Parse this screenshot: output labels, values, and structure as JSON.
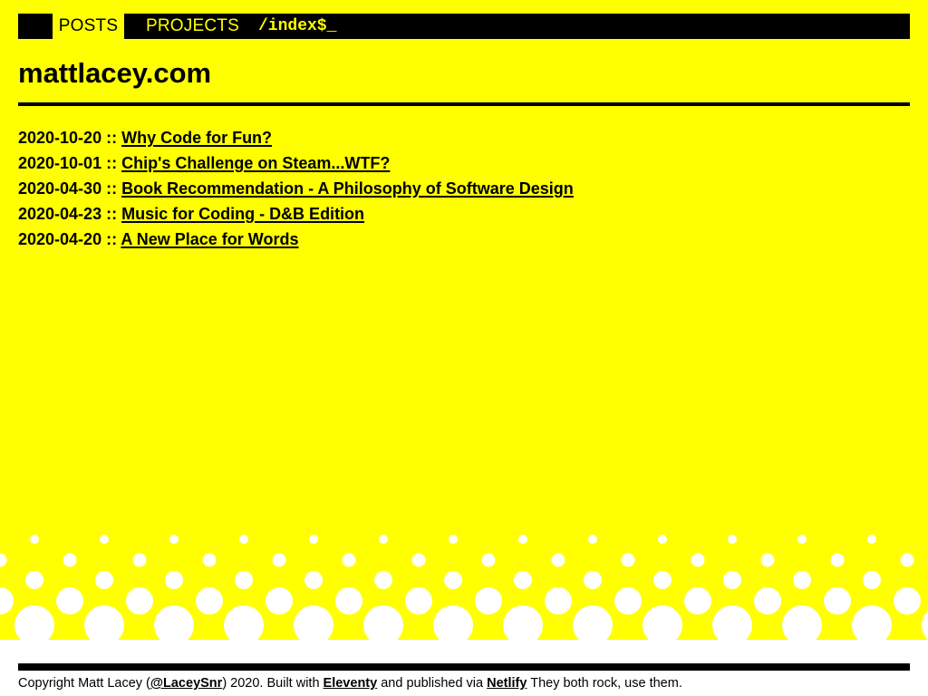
{
  "nav": {
    "posts_label": "POSTS",
    "projects_label": "PROJECTS",
    "path_label": "/index$_"
  },
  "site": {
    "title": "mattlacey.com"
  },
  "posts": [
    {
      "date": "2020-10-20",
      "separator": " :: ",
      "title": "Why Code for Fun?"
    },
    {
      "date": "2020-10-01",
      "separator": " :: ",
      "title": "Chip's Challenge on Steam...WTF?"
    },
    {
      "date": "2020-04-30",
      "separator": " :: ",
      "title": "Book Recommendation - A Philosophy of Software Design"
    },
    {
      "date": "2020-04-23",
      "separator": " :: ",
      "title": "Music for Coding - D&B Edition"
    },
    {
      "date": "2020-04-20",
      "separator": " :: ",
      "title": "A New Place for Words"
    }
  ],
  "footer": {
    "text_1": "Copyright Matt Lacey (",
    "twitter_link": "@LaceySnr",
    "text_2": ") 2020. Built with ",
    "eleventy_link": "Eleventy",
    "text_3": " and published via ",
    "netlify_link": "Netlify",
    "text_4": " They both rock, use them."
  },
  "colors": {
    "background": "#ffff00",
    "text": "#000000",
    "dots": "#ffffff"
  }
}
